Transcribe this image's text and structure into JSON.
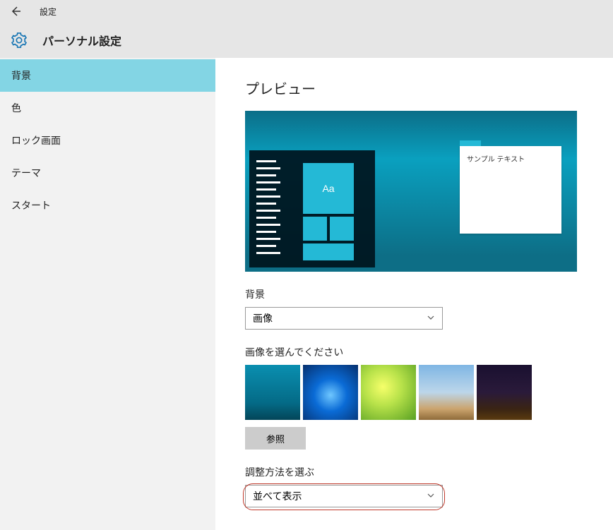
{
  "titlebar": {
    "title": "設定"
  },
  "header": {
    "caption": "パーソナル設定"
  },
  "sidebar": {
    "items": [
      {
        "label": "背景",
        "selected": true
      },
      {
        "label": "色",
        "selected": false
      },
      {
        "label": "ロック画面",
        "selected": false
      },
      {
        "label": "テーマ",
        "selected": false
      },
      {
        "label": "スタート",
        "selected": false
      }
    ]
  },
  "content": {
    "preview_heading": "プレビュー",
    "preview_tile_text": "Aa",
    "sample_text": "サンプル テキスト",
    "background_label": "背景",
    "background_selected": "画像",
    "choose_image_label": "画像を選んでください",
    "thumbs": [
      {
        "name": "underwater"
      },
      {
        "name": "windows-light"
      },
      {
        "name": "green-leaf"
      },
      {
        "name": "beach"
      },
      {
        "name": "night-sky"
      }
    ],
    "browse_label": "参照",
    "fit_label": "調整方法を選ぶ",
    "fit_selected": "並べて表示"
  }
}
